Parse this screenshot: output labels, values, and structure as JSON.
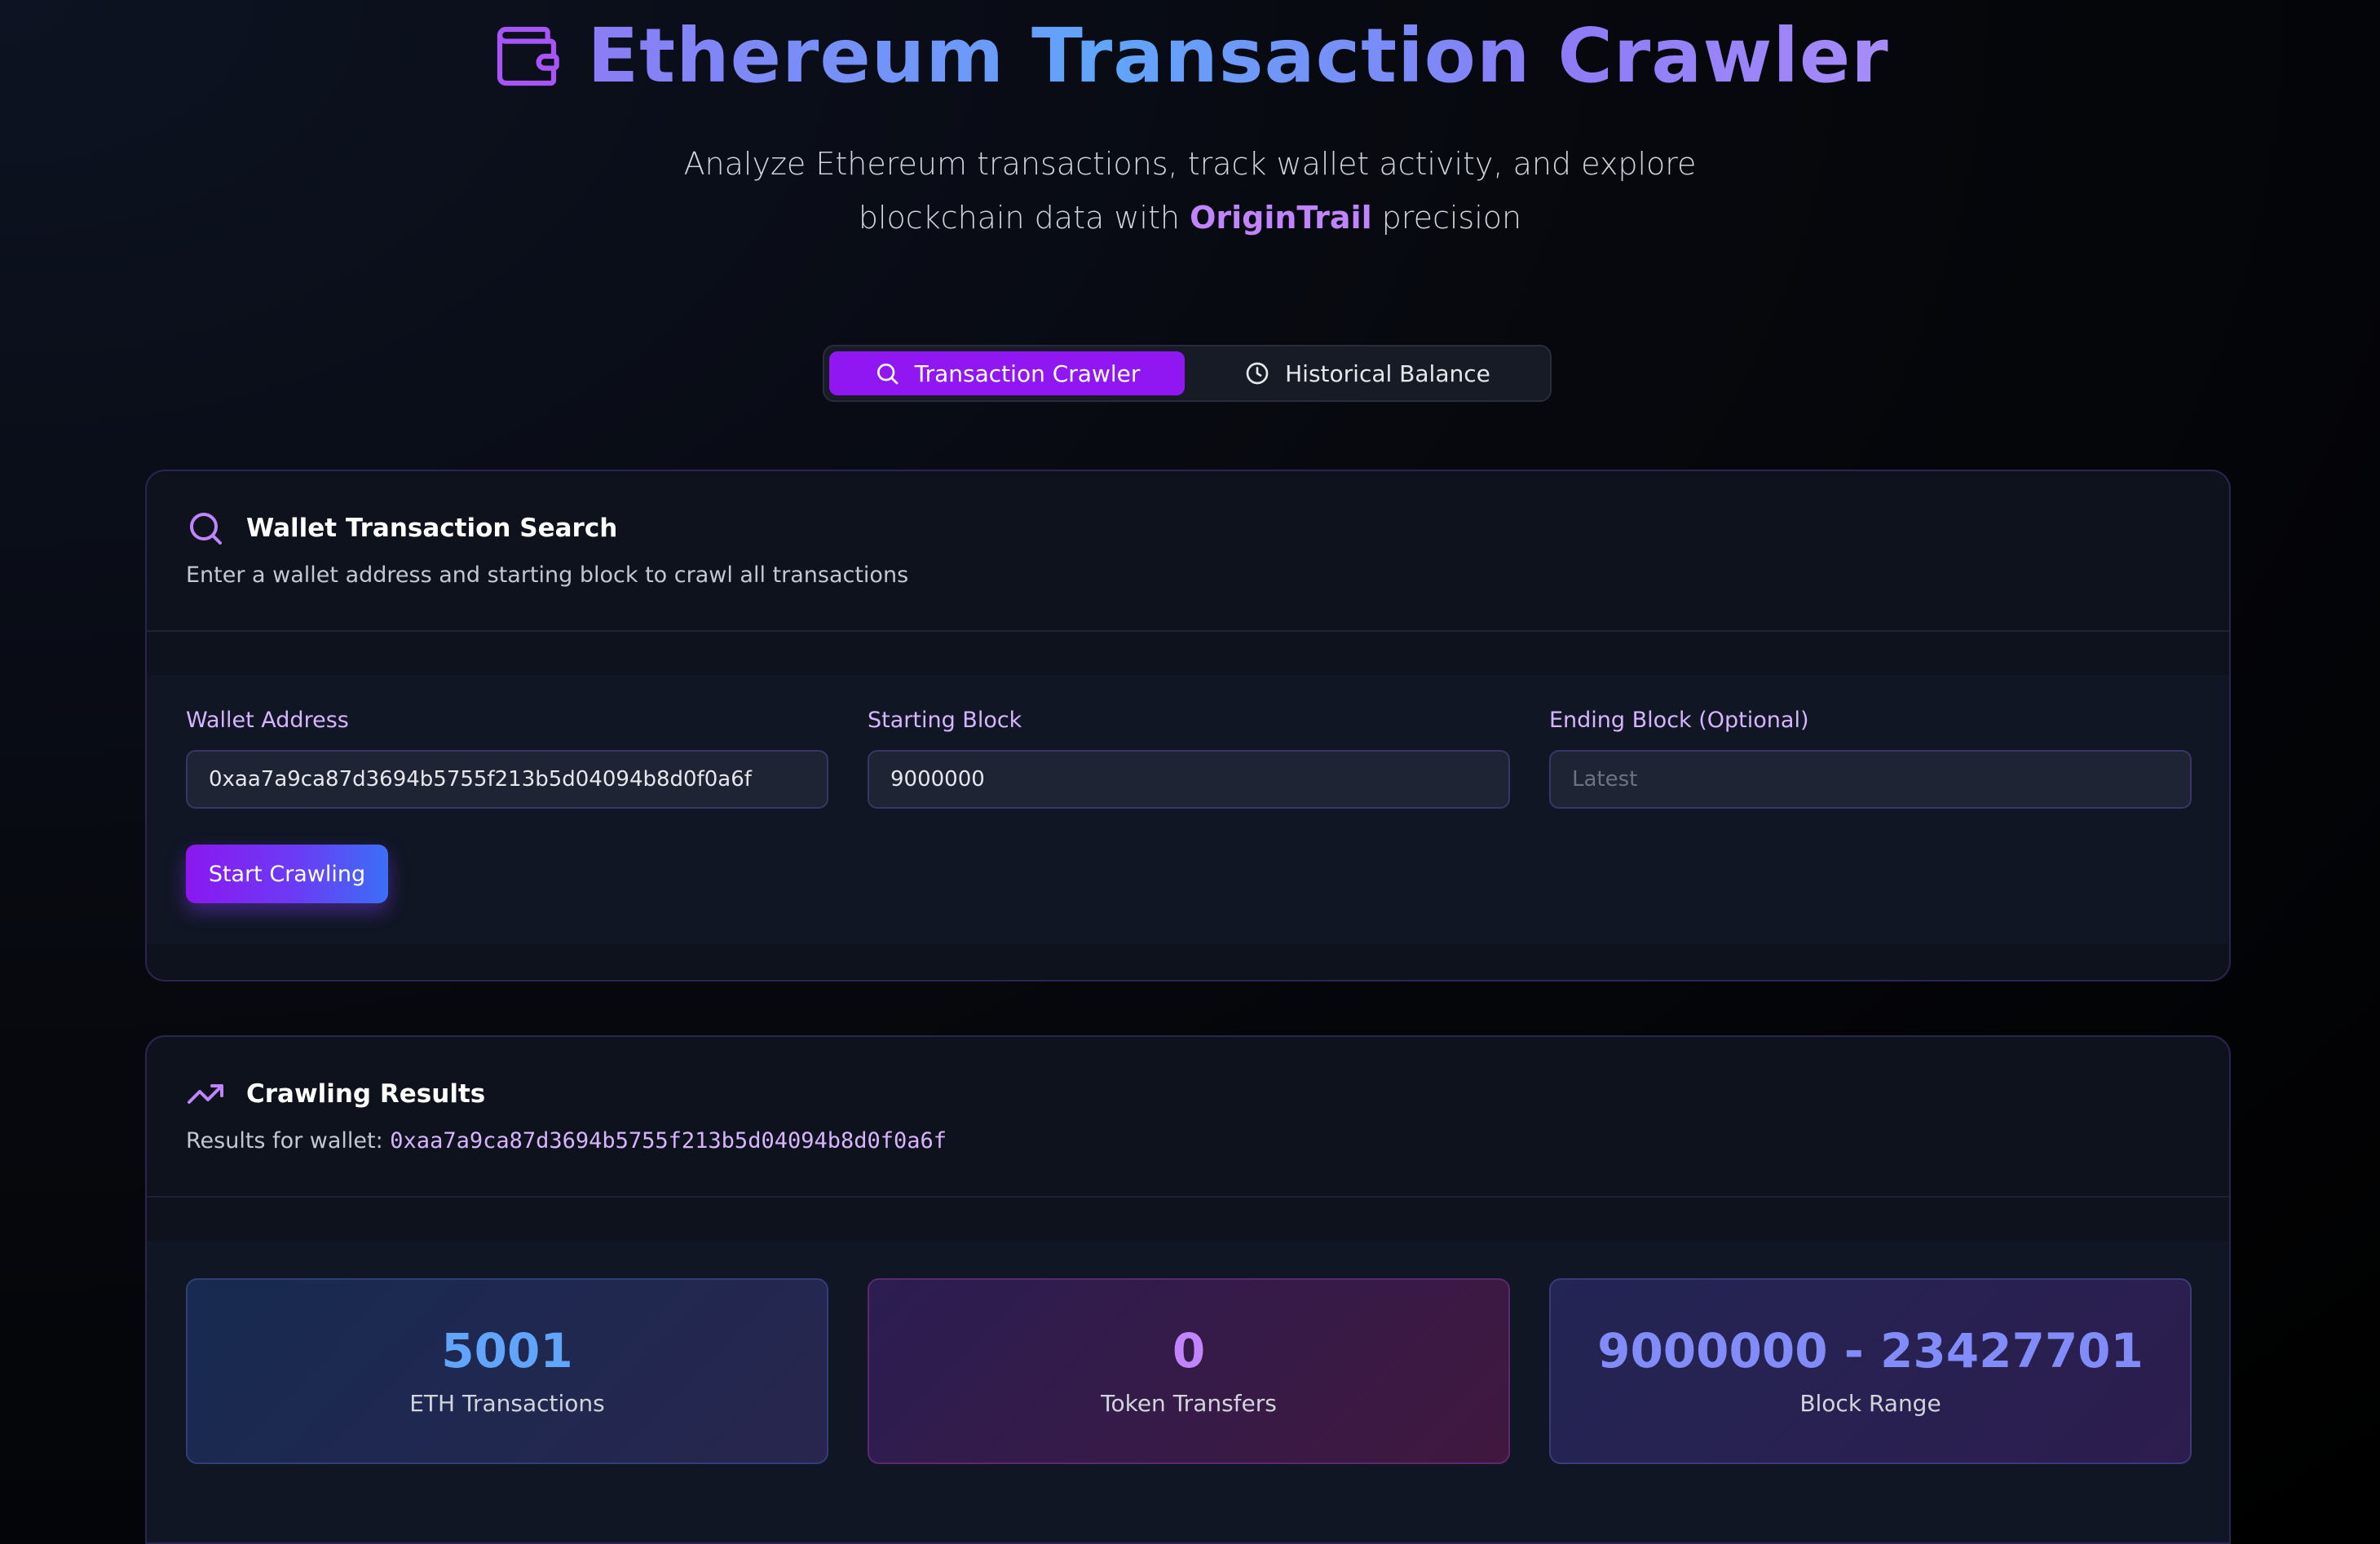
{
  "header": {
    "title": "Ethereum Transaction Crawler",
    "icon": "wallet-icon",
    "subtitle_line1": "Analyze Ethereum transactions, track wallet activity, and explore",
    "subtitle_line2_prefix": "blockchain data with ",
    "subtitle_brand": "OriginTrail",
    "subtitle_line2_suffix": " precision"
  },
  "tabs": [
    {
      "label": "Transaction Crawler",
      "icon": "search-icon",
      "active": true
    },
    {
      "label": "Historical Balance",
      "icon": "clock-icon",
      "active": false
    }
  ],
  "search_card": {
    "icon": "search-icon",
    "title": "Wallet Transaction Search",
    "description": "Enter a wallet address and starting block to crawl all transactions",
    "fields": {
      "wallet": {
        "label": "Wallet Address",
        "value": "0xaa7a9ca87d3694b5755f213b5d04094b8d0f0a6f",
        "placeholder": ""
      },
      "start_block": {
        "label": "Starting Block",
        "value": "9000000",
        "placeholder": ""
      },
      "end_block": {
        "label": "Ending Block (Optional)",
        "value": "",
        "placeholder": "Latest"
      }
    },
    "submit_label": "Start Crawling"
  },
  "results_card": {
    "icon": "trending-up-icon",
    "title": "Crawling Results",
    "description_prefix": "Results for wallet: ",
    "wallet": "0xaa7a9ca87d3694b5755f213b5d04094b8d0f0a6f",
    "stats": [
      {
        "value": "5001",
        "label": "ETH Transactions"
      },
      {
        "value": "0",
        "label": "Token Transfers"
      },
      {
        "value": "9000000 - 23427701",
        "label": "Block Range"
      }
    ]
  },
  "colors": {
    "accent_purple": "#9117f2",
    "brand_text": "#c084fc",
    "eth_value": "#60a5fa",
    "token_value": "#c084fc",
    "range_value": "#818cf8"
  }
}
